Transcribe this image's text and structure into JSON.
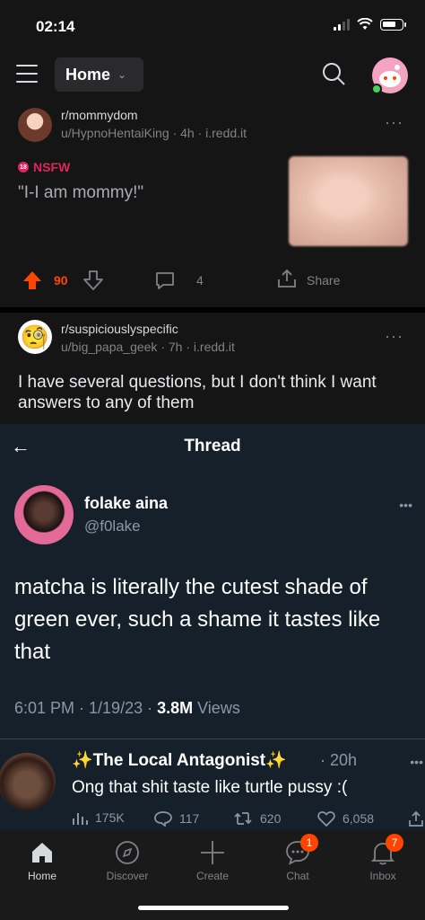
{
  "status_bar": {
    "time": "02:14"
  },
  "top_nav": {
    "feed_label": "Home"
  },
  "posts": [
    {
      "subreddit": "r/mommydom",
      "author": "u/HypnoHentaiKing",
      "age": "4h",
      "domain": "i.redd.it",
      "nsfw_label": "NSFW",
      "title": "\"I-I am mommy!\"",
      "votes": "90",
      "comments": "4",
      "share_label": "Share"
    },
    {
      "subreddit": "r/suspiciouslyspecific",
      "author": "u/big_papa_geek",
      "age": "7h",
      "domain": "i.redd.it",
      "title": "I have several questions, but I don't think I want answers to any of them",
      "avatar_emoji": "🧐"
    }
  ],
  "tweet": {
    "header": "Thread",
    "name": "folake aina",
    "handle": "@f0lake",
    "body": "matcha is literally the cutest shade of green ever, such a shame it tastes like that",
    "timestamp": "6:01 PM · 1/19/23 · ",
    "views_count": "3.8M",
    "views_label": " Views",
    "reply": {
      "name": "✨The Local Antagonist✨",
      "time": "· 20h",
      "text": "Ong that shit taste like turtle pussy :(",
      "views": "175K",
      "replies": "117",
      "retweets": "620",
      "likes": "6,058"
    }
  },
  "bottom_nav": {
    "tabs": [
      {
        "label": "Home",
        "icon": "home-icon"
      },
      {
        "label": "Discover",
        "icon": "compass-icon"
      },
      {
        "label": "Create",
        "icon": "plus-icon"
      },
      {
        "label": "Chat",
        "icon": "chat-icon",
        "badge": "1"
      },
      {
        "label": "Inbox",
        "icon": "bell-icon",
        "badge": "7"
      }
    ]
  },
  "colors": {
    "upvote": "#ff4500",
    "nsfw": "#e0245e",
    "twitter_bg": "#15202b"
  }
}
